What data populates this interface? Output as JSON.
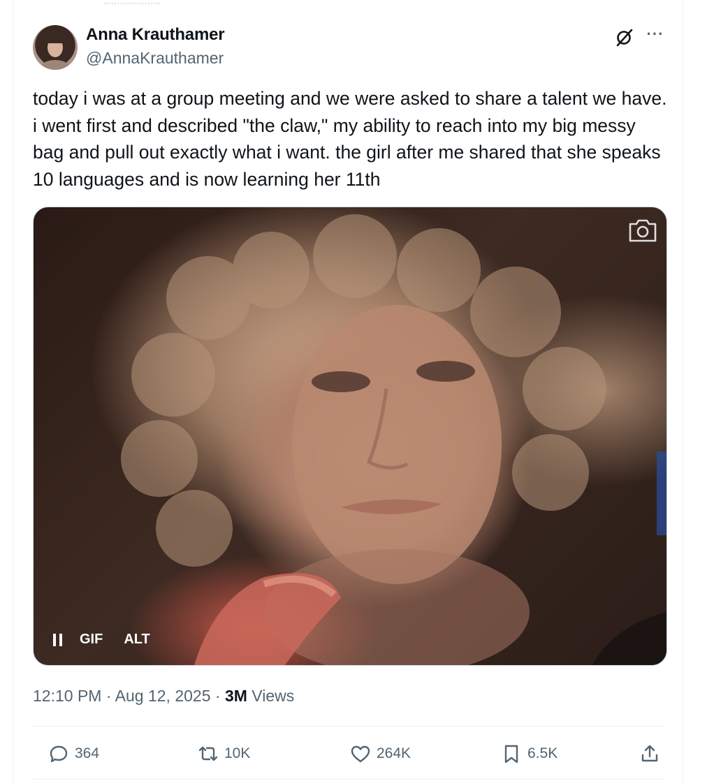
{
  "author": {
    "display_name": "Anna Krauthamer",
    "handle": "@AnnaKrauthamer"
  },
  "tweet": {
    "text": "today i was at a group meeting and we were asked to share a talent we have. i went first and described \"the claw,\" my ability to reach into my big messy bag and pull out exactly what i want. the girl after me shared that she speaks 10 languages and is now learning her 11th"
  },
  "media": {
    "type_label": "GIF",
    "alt_label": "ALT",
    "icons": [
      "camera-icon",
      "pause-icon"
    ]
  },
  "meta": {
    "time": "12:10 PM",
    "separator": "·",
    "date": "Aug 12, 2025",
    "views_count": "3M",
    "views_label": "Views"
  },
  "actions": {
    "replies": "364",
    "reposts": "10K",
    "likes": "264K",
    "bookmarks": "6.5K"
  },
  "colors": {
    "text": "#0f1419",
    "secondary": "#536471",
    "border": "#eff3f4"
  }
}
